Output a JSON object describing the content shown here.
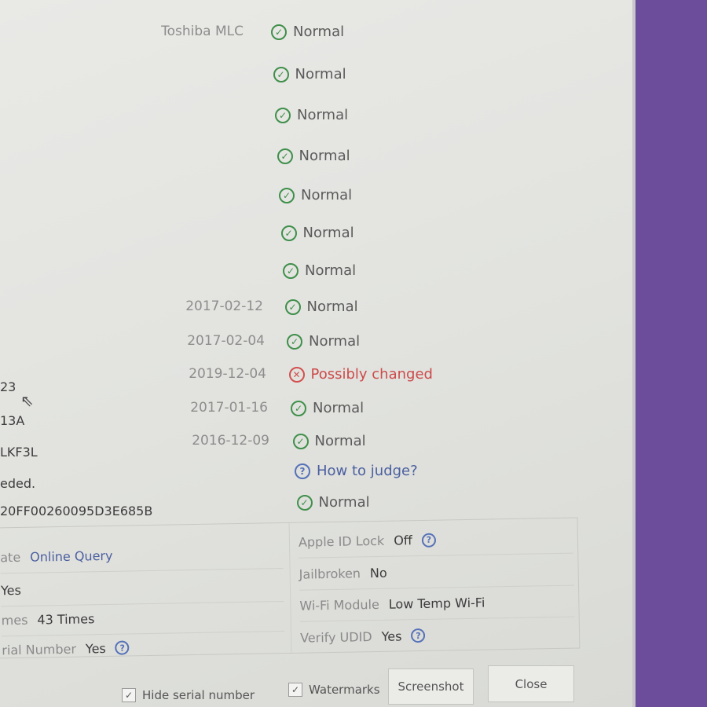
{
  "rows": [
    {
      "left": "Toshiba MLC",
      "status": "Normal",
      "type": "ok"
    },
    {
      "left": "",
      "status": "Normal",
      "type": "ok"
    },
    {
      "left": "",
      "status": "Normal",
      "type": "ok"
    },
    {
      "left": "",
      "status": "Normal",
      "type": "ok"
    },
    {
      "left": "",
      "status": "Normal",
      "type": "ok"
    },
    {
      "left": "",
      "status": "Normal",
      "type": "ok"
    },
    {
      "left": "",
      "status": "Normal",
      "type": "ok"
    },
    {
      "left": "2017-02-12",
      "status": "Normal",
      "type": "ok"
    },
    {
      "left": "2017-02-04",
      "status": "Normal",
      "type": "ok"
    },
    {
      "left": "2019-12-04",
      "status": "Possibly changed",
      "type": "bad"
    },
    {
      "left": "2017-01-16",
      "status": "Normal",
      "type": "ok"
    },
    {
      "left": "2016-12-09",
      "status": "Normal",
      "type": "ok"
    },
    {
      "left": "",
      "status": "How to judge?",
      "type": "q"
    },
    {
      "left": "",
      "status": "Normal",
      "type": "ok"
    }
  ],
  "left_fragments": [
    "23",
    "13A",
    "LKF3L",
    "eded.",
    "20FF00260095D3E685B"
  ],
  "table": {
    "left": [
      {
        "label": "ate",
        "value": "Online Query"
      },
      {
        "label": "",
        "value": "Yes"
      },
      {
        "label": "mes",
        "value": "43 Times"
      },
      {
        "label": "rial Number",
        "value": "Yes"
      }
    ],
    "right": [
      {
        "label": "Apple ID Lock",
        "value": "Off"
      },
      {
        "label": "Jailbroken",
        "value": "No"
      },
      {
        "label": "Wi-Fi Module",
        "value": "Low Temp Wi-Fi"
      },
      {
        "label": "Verify UDID",
        "value": "Yes"
      }
    ]
  },
  "footer": {
    "hide_serial": "Hide serial number",
    "watermarks": "Watermarks",
    "screenshot": "Screenshot",
    "close": "Close"
  },
  "colors": {
    "ok": "#3f8f4a",
    "bad": "#d2504f",
    "help": "#5571b8",
    "background": "#6b4d9c"
  }
}
